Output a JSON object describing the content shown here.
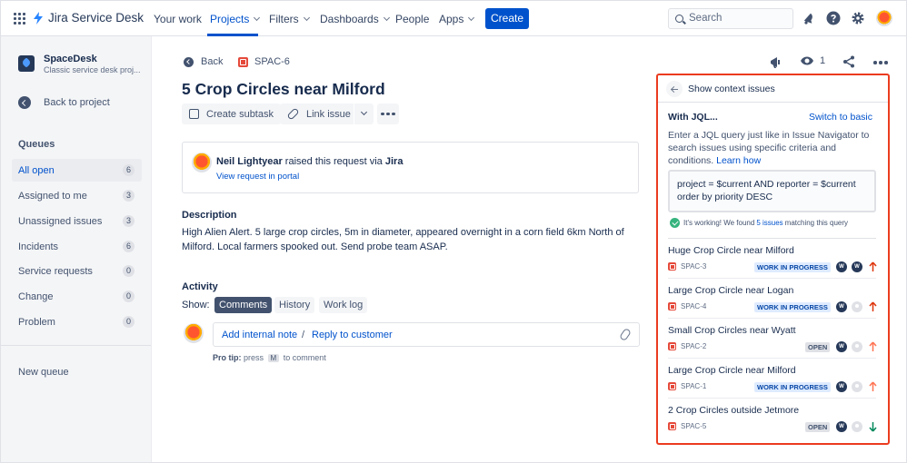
{
  "app": {
    "name": "Jira Service Desk"
  },
  "topnav": {
    "items": [
      {
        "label": "Your work"
      },
      {
        "label": "Projects"
      },
      {
        "label": "Filters"
      },
      {
        "label": "Dashboards"
      },
      {
        "label": "People"
      },
      {
        "label": "Apps"
      }
    ],
    "active": "Projects",
    "create_label": "Create",
    "search_placeholder": "Search"
  },
  "sidebar": {
    "project_name": "SpaceDesk",
    "project_type": "Classic service desk proj...",
    "back_label": "Back to project",
    "queues_title": "Queues",
    "queues": [
      {
        "label": "All open",
        "count": "6"
      },
      {
        "label": "Assigned to me",
        "count": "3"
      },
      {
        "label": "Unassigned issues",
        "count": "3"
      },
      {
        "label": "Incidents",
        "count": "6"
      },
      {
        "label": "Service requests",
        "count": "0"
      },
      {
        "label": "Change",
        "count": "0"
      },
      {
        "label": "Problem",
        "count": "0"
      }
    ],
    "new_queue_label": "New queue"
  },
  "issue": {
    "back_label": "Back",
    "key": "SPAC-6",
    "title": "5 Crop Circles near Milford",
    "watch_count": "1",
    "buttons": {
      "create_subtask": "Create subtask",
      "link_issue": "Link issue"
    },
    "request": {
      "reporter": "Neil Lightyear",
      "via_text": " raised this request via ",
      "channel": "Jira",
      "portal_link": "View request in portal"
    },
    "description_heading": "Description",
    "description": "High Alien Alert. 5 large crop circles, 5m in diameter, appeared overnight in a corn field 6km North of Milford. Local farmers spooked out. Send probe team ASAP.",
    "activity_heading": "Activity",
    "show_label": "Show:",
    "activity_tabs": [
      "Comments",
      "History",
      "Work log"
    ],
    "comment": {
      "add_note": "Add internal note",
      "separator": "/",
      "reply": "Reply to customer"
    },
    "protip": {
      "prefix": "Pro tip:",
      "press": " press ",
      "key": "M",
      "suffix": " to comment"
    }
  },
  "context_panel": {
    "title": "Show context issues",
    "jql_title": "With JQL...",
    "switch_label": "Switch to basic",
    "help_text": "Enter a JQL query just like in Issue Navigator to search issues using specific criteria and conditions.",
    "learn_how": "Learn how",
    "query": "project = $current AND reporter = $current order by priority DESC",
    "status_prefix": "It's working! We found ",
    "status_count": "5 issues",
    "status_suffix": " matching this query",
    "issues": [
      {
        "title": "Huge Crop Circle near Milford",
        "key": "SPAC-3",
        "status": "WORK IN PROGRESS",
        "priority": "high"
      },
      {
        "title": "Large Crop Circle near Logan",
        "key": "SPAC-4",
        "status": "WORK IN PROGRESS",
        "priority": "high"
      },
      {
        "title": "Small Crop Circles near Wyatt",
        "key": "SPAC-2",
        "status": "OPEN",
        "priority": "medium"
      },
      {
        "title": "Large Crop Circle near Milford",
        "key": "SPAC-1",
        "status": "WORK IN PROGRESS",
        "priority": "medium"
      },
      {
        "title": "2 Crop Circles outside Jetmore",
        "key": "SPAC-5",
        "status": "OPEN",
        "priority": "low"
      }
    ],
    "avatar_initial": "W"
  },
  "colors": {
    "brand": "#0052CC",
    "highlight_border": "#EB3B1F",
    "text": "#172B4D",
    "success": "#36B37E"
  }
}
